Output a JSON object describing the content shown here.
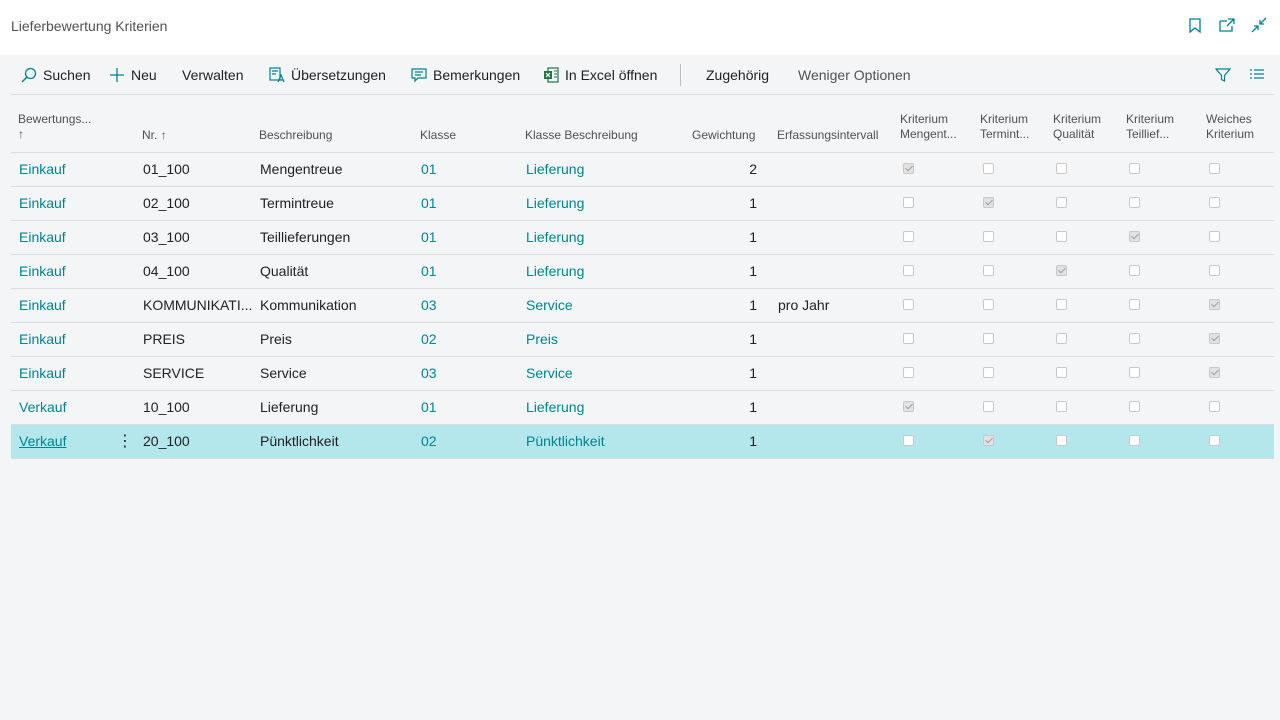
{
  "page": {
    "title": "Lieferbewertung Kriterien"
  },
  "header_icons": [
    "bookmark-icon",
    "open-in-new-window-icon",
    "collapse-icon"
  ],
  "toolbar": {
    "search": "Suchen",
    "new": "Neu",
    "manage": "Verwalten",
    "translations": "Übersetzungen",
    "comments": "Bemerkungen",
    "excel": "In Excel öffnen",
    "related": "Zugehörig",
    "fewer": "Weniger Optionen"
  },
  "columns": {
    "bewertung": "Bewertungs...",
    "bewertung_sort": "↑",
    "nr": "Nr. ↑",
    "beschreibung": "Beschreibung",
    "klasse": "Klasse",
    "klasse_beschreibung": "Klasse Beschreibung",
    "gewichtung": "Gewichtung",
    "erfassung": "Erfassungsintervall",
    "k_menge_1": "Kriterium",
    "k_menge_2": "Mengent...",
    "k_termin_1": "Kriterium",
    "k_termin_2": "Termint...",
    "k_qual_1": "Kriterium",
    "k_qual_2": "Qualität",
    "k_teil_1": "Kriterium",
    "k_teil_2": "Teillief...",
    "weich_1": "Weiches",
    "weich_2": "Kriterium"
  },
  "rows": [
    {
      "bewertung": "Einkauf",
      "nr": "01_100",
      "beschreibung": "Mengentreue",
      "klasse": "01",
      "klasse_beschreibung": "Lieferung",
      "gewichtung": "2",
      "erfassung": "",
      "checks": [
        true,
        false,
        false,
        false,
        false
      ]
    },
    {
      "bewertung": "Einkauf",
      "nr": "02_100",
      "beschreibung": "Termintreue",
      "klasse": "01",
      "klasse_beschreibung": "Lieferung",
      "gewichtung": "1",
      "erfassung": "",
      "checks": [
        false,
        true,
        false,
        false,
        false
      ]
    },
    {
      "bewertung": "Einkauf",
      "nr": "03_100",
      "beschreibung": "Teillieferungen",
      "klasse": "01",
      "klasse_beschreibung": "Lieferung",
      "gewichtung": "1",
      "erfassung": "",
      "checks": [
        false,
        false,
        false,
        true,
        false
      ]
    },
    {
      "bewertung": "Einkauf",
      "nr": "04_100",
      "beschreibung": "Qualität",
      "klasse": "01",
      "klasse_beschreibung": "Lieferung",
      "gewichtung": "1",
      "erfassung": "",
      "checks": [
        false,
        false,
        true,
        false,
        false
      ]
    },
    {
      "bewertung": "Einkauf",
      "nr": "KOMMUNIKATI...",
      "beschreibung": "Kommunikation",
      "klasse": "03",
      "klasse_beschreibung": "Service",
      "gewichtung": "1",
      "erfassung": "pro Jahr",
      "checks": [
        false,
        false,
        false,
        false,
        true
      ]
    },
    {
      "bewertung": "Einkauf",
      "nr": "PREIS",
      "beschreibung": "Preis",
      "klasse": "02",
      "klasse_beschreibung": "Preis",
      "gewichtung": "1",
      "erfassung": "",
      "checks": [
        false,
        false,
        false,
        false,
        true
      ]
    },
    {
      "bewertung": "Einkauf",
      "nr": "SERVICE",
      "beschreibung": "Service",
      "klasse": "03",
      "klasse_beschreibung": "Service",
      "gewichtung": "1",
      "erfassung": "",
      "checks": [
        false,
        false,
        false,
        false,
        true
      ]
    },
    {
      "bewertung": "Verkauf",
      "nr": "10_100",
      "beschreibung": "Lieferung",
      "klasse": "01",
      "klasse_beschreibung": "Lieferung",
      "gewichtung": "1",
      "erfassung": "",
      "checks": [
        true,
        false,
        false,
        false,
        false
      ]
    },
    {
      "bewertung": "Verkauf",
      "nr": "20_100",
      "beschreibung": "Pünktlichkeit",
      "klasse": "02",
      "klasse_beschreibung": "Pünktlichkeit",
      "gewichtung": "1",
      "erfassung": "",
      "checks": [
        false,
        true,
        false,
        false,
        false
      ],
      "selected": true
    }
  ],
  "colors": {
    "accent": "#00838f",
    "selected_row": "#b3e7ec"
  }
}
